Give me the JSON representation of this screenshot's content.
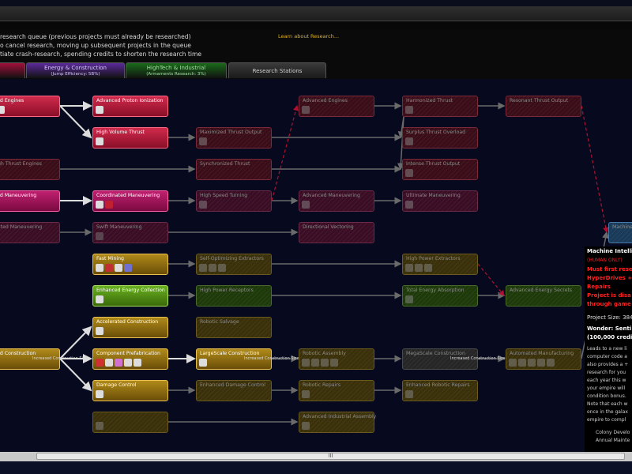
{
  "header": {
    "lines": [
      "research queue (previous projects must already be researched)",
      "o cancel research, moving up subsequent projects in the queue",
      "tiate crash-research, spending credits to shorten the research time"
    ],
    "learn_link": "Learn about Research..."
  },
  "tabs": [
    {
      "label": "",
      "sublabel": "",
      "color": "#a0103a",
      "text_color": "#ffffff",
      "active": false
    },
    {
      "label": "Energy & Construction",
      "sublabel": "(Jump Efficiency: 5B%)",
      "color": "#5a2a9a",
      "text_color": "#d8c8ff",
      "active": false
    },
    {
      "label": "HighTech & Industrial",
      "sublabel": "(Armaments Research: 3%)",
      "color": "#1a6a1a",
      "text_color": "#a0e0a0",
      "active": false
    },
    {
      "label": "Research Stations",
      "sublabel": "",
      "color": "#2a2a2a",
      "text_color": "#cfcfcf",
      "active": true
    }
  ],
  "nodes": [
    {
      "id": "n1",
      "label": "anced Engines",
      "sub": "",
      "style": "c-red",
      "icons": [
        "#b01030",
        "#ddd"
      ]
    },
    {
      "id": "n2",
      "label": "Advanced Proton Ionization",
      "sub": "",
      "style": "c-red",
      "icons": [
        "#ddd"
      ]
    },
    {
      "id": "n3",
      "label": "High Volume Thrust",
      "sub": "",
      "style": "c-red",
      "icons": [
        "#ddd"
      ]
    },
    {
      "id": "n4",
      "label": "y High Thrust Engines",
      "sub": "",
      "style": "dim d-red",
      "icons": []
    },
    {
      "id": "n5",
      "label": "anced Maneuvering",
      "sub": "",
      "style": "c-mag",
      "icons": [
        "#ddd"
      ]
    },
    {
      "id": "n6",
      "label": "Coordinated Maneuvering",
      "sub": "",
      "style": "c-mag",
      "icons": [
        "#ddd",
        "#c02030"
      ]
    },
    {
      "id": "n7",
      "label": "elerated Maneuvering",
      "sub": "",
      "style": "dim d-mag",
      "icons": [
        "#777"
      ]
    },
    {
      "id": "n8",
      "label": "Swift Maneuvering",
      "sub": "",
      "style": "dim d-mag",
      "icons": [
        "#777"
      ]
    },
    {
      "id": "n9",
      "label": "Fast Mining",
      "sub": "",
      "style": "c-gold",
      "icons": [
        "#ddd",
        "#c03030",
        "#dddddd",
        "#7070d0"
      ]
    },
    {
      "id": "n10",
      "label": "Enhanced Energy Collection",
      "sub": "",
      "style": "c-green",
      "icons": [
        "#ddd"
      ]
    },
    {
      "id": "n11",
      "label": "Accelerated Construction",
      "sub": "",
      "style": "c-gold",
      "icons": [
        "#ddd"
      ]
    },
    {
      "id": "n12",
      "label": "anced Construction",
      "sub": "Increased Construction Size",
      "style": "c-gold",
      "icons": []
    },
    {
      "id": "n13",
      "label": "Component Prefabrication",
      "sub": "",
      "style": "c-gold",
      "icons": [
        "#d03030",
        "#ddd",
        "#d070d0",
        "#ddd",
        "#ddd"
      ]
    },
    {
      "id": "n14",
      "label": "Damage Control",
      "sub": "",
      "style": "c-gold",
      "icons": [
        "#ddd"
      ]
    },
    {
      "id": "n15",
      "label": "",
      "sub": "",
      "style": "dim d-gold",
      "icons": [
        "#888"
      ]
    },
    {
      "id": "n16",
      "label": "Maximized Thrust Output",
      "sub": "",
      "style": "dim d-red",
      "icons": [
        "#888"
      ]
    },
    {
      "id": "n17",
      "label": "Synchronized Thrust",
      "sub": "",
      "style": "dim d-red",
      "icons": []
    },
    {
      "id": "n18",
      "label": "High Speed Turning",
      "sub": "",
      "style": "dim d-mag",
      "icons": [
        "#888"
      ]
    },
    {
      "id": "n19",
      "label": "Self-Optimizing Extractors",
      "sub": "",
      "style": "dim d-gold",
      "icons": [
        "#888",
        "#888",
        "#888"
      ]
    },
    {
      "id": "n20",
      "label": "High Power Receptors",
      "sub": "",
      "style": "dim d-green",
      "icons": []
    },
    {
      "id": "n21",
      "label": "Robotic Salvage",
      "sub": "",
      "style": "dim d-gold",
      "icons": []
    },
    {
      "id": "n22",
      "label": "LargeScale Construction",
      "sub": "Increased Construction Size",
      "style": "c-gold",
      "icons": [
        "#ddd"
      ]
    },
    {
      "id": "n23",
      "label": "Enhanced Damage Control",
      "sub": "",
      "style": "dim d-gold",
      "icons": []
    },
    {
      "id": "n24",
      "label": "Advanced Engines",
      "sub": "",
      "style": "dim d-red",
      "icons": [
        "#888"
      ]
    },
    {
      "id": "n25",
      "label": "Advanced Maneuvering",
      "sub": "",
      "style": "dim d-mag",
      "icons": [
        "#888"
      ]
    },
    {
      "id": "n26",
      "label": "Directional Vectoring",
      "sub": "",
      "style": "dim d-mag",
      "icons": []
    },
    {
      "id": "n27",
      "label": "Robotic Assembly",
      "sub": "",
      "style": "dim d-gold",
      "icons": [
        "#888",
        "#888",
        "#888",
        "#888"
      ]
    },
    {
      "id": "n28",
      "label": "Robotic Repairs",
      "sub": "",
      "style": "dim d-gold",
      "icons": [
        "#888"
      ]
    },
    {
      "id": "n29",
      "label": "Advanced Industrial Assembly",
      "sub": "",
      "style": "dim d-gold",
      "icons": [
        "#888"
      ]
    },
    {
      "id": "n30",
      "label": "Harmonized Thrust",
      "sub": "",
      "style": "dim d-red",
      "icons": [
        "#888"
      ]
    },
    {
      "id": "n31",
      "label": "Surplus Thrust Overload",
      "sub": "",
      "style": "dim d-red",
      "icons": [
        "#888"
      ]
    },
    {
      "id": "n32",
      "label": "Intense Thrust Output",
      "sub": "",
      "style": "dim d-red",
      "icons": [
        "#888"
      ]
    },
    {
      "id": "n33",
      "label": "Ultimate Maneuvering",
      "sub": "",
      "style": "dim d-mag",
      "icons": [
        "#888"
      ]
    },
    {
      "id": "n34",
      "label": "High Power Extractors",
      "sub": "",
      "style": "dim d-gold",
      "icons": [
        "#888",
        "#888",
        "#888"
      ]
    },
    {
      "id": "n35",
      "label": "Total Energy Absorption",
      "sub": "",
      "style": "dim d-green",
      "icons": [
        "#888"
      ]
    },
    {
      "id": "n36",
      "label": "MegaScale Construction",
      "sub": "Increased Construction Size",
      "style": "dim d-grey",
      "icons": []
    },
    {
      "id": "n37",
      "label": "Enhanced Robotic Repairs",
      "sub": "",
      "style": "dim d-gold",
      "icons": [
        "#888"
      ]
    },
    {
      "id": "n38",
      "label": "Resonant Thrust Output",
      "sub": "",
      "style": "dim d-red",
      "icons": []
    },
    {
      "id": "n39",
      "label": "Advanced Energy Secrets",
      "sub": "",
      "style": "dim d-green",
      "icons": []
    },
    {
      "id": "n40",
      "label": "Automated Manufacturing",
      "sub": "",
      "style": "dim d-gold",
      "icons": [
        "#888",
        "#888",
        "#888",
        "#888",
        "#888"
      ]
    },
    {
      "id": "n41",
      "label": "Machine Intelli",
      "sub": "",
      "style": "dim d-blue",
      "icons": []
    }
  ],
  "side_panel": [
    {
      "text": "Machine Intelli",
      "color": "#ffffff",
      "size": 7,
      "bold": true
    },
    {
      "text": "(HUMAN ONLY)",
      "color": "#e0202a",
      "size": 6,
      "bold": false
    },
    {
      "text": "Must first rese",
      "color": "#ff2020",
      "size": 7,
      "bold": true
    },
    {
      "text": "HyperDrives +",
      "color": "#ff2020",
      "size": 7,
      "bold": true
    },
    {
      "text": "Repairs",
      "color": "#ff2020",
      "size": 7,
      "bold": true
    },
    {
      "text": "Project is disa",
      "color": "#ff2020",
      "size": 7,
      "bold": true
    },
    {
      "text": "through game",
      "color": "#ff2020",
      "size": 7,
      "bold": true
    },
    {
      "text": "Project Size: 384",
      "color": "#e0e0e0",
      "size": 7,
      "bold": false
    },
    {
      "text": "Wonder: Senti",
      "color": "#ffffff",
      "size": 7,
      "bold": true
    },
    {
      "text": "(100,000 credit",
      "color": "#ffffff",
      "size": 7,
      "bold": true
    },
    {
      "text": "Leads to a new li",
      "color": "#d0d0d0",
      "size": 6,
      "bold": false
    },
    {
      "text": "computer code a",
      "color": "#d0d0d0",
      "size": 6,
      "bold": false
    },
    {
      "text": "also provides a +",
      "color": "#d0d0d0",
      "size": 6,
      "bold": false
    },
    {
      "text": "research for you",
      "color": "#d0d0d0",
      "size": 6,
      "bold": false
    },
    {
      "text": "each year this w",
      "color": "#d0d0d0",
      "size": 6,
      "bold": false
    },
    {
      "text": "your empire will",
      "color": "#d0d0d0",
      "size": 6,
      "bold": false
    },
    {
      "text": "condition bonus.",
      "color": "#d0d0d0",
      "size": 6,
      "bold": false
    },
    {
      "text": "Note that each w",
      "color": "#d0d0d0",
      "size": 6,
      "bold": false
    },
    {
      "text": "once in the galax",
      "color": "#d0d0d0",
      "size": 6,
      "bold": false
    },
    {
      "text": "empire to compl",
      "color": "#d0d0d0",
      "size": 6,
      "bold": false
    },
    {
      "text": "Colony Develo",
      "color": "#d0d0d0",
      "size": 6,
      "bold": false
    },
    {
      "text": "Annual Mainte",
      "color": "#d0d0d0",
      "size": 6,
      "bold": false
    }
  ],
  "scrollbar": {
    "grip": "III"
  }
}
